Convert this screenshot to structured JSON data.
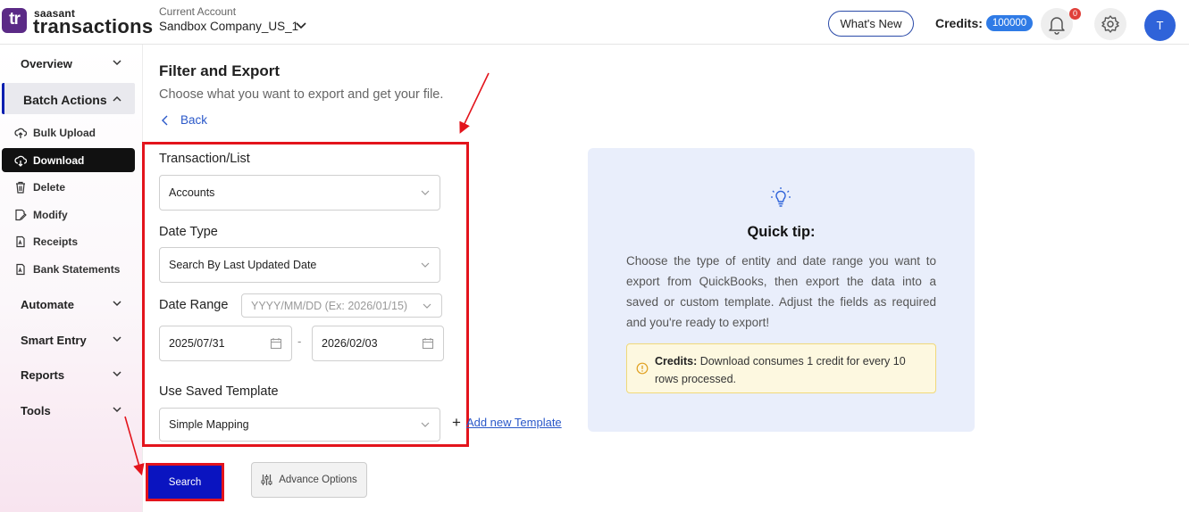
{
  "header": {
    "logo_mark": "tr",
    "logo_small": "saasant",
    "logo_big": "transactions",
    "account_label": "Current Account",
    "account_name": "Sandbox Company_US_1",
    "whats_new_label": "What's New",
    "credits_label": "Credits:",
    "credits_value": "100000",
    "notification_count": "0",
    "avatar_initial": "T",
    "icons": [
      "chevron-down-icon",
      "bell-icon",
      "gear-icon"
    ]
  },
  "sidebar": {
    "sections": [
      {
        "label": "Overview"
      },
      {
        "label": "Batch Actions"
      },
      {
        "label": "Automate"
      },
      {
        "label": "Smart Entry"
      },
      {
        "label": "Reports"
      },
      {
        "label": "Tools"
      }
    ],
    "batch_items": [
      {
        "label": "Bulk Upload",
        "icon": "cloud-upload-icon"
      },
      {
        "label": "Download",
        "icon": "cloud-download-icon",
        "active": true
      },
      {
        "label": "Delete",
        "icon": "trash-icon"
      },
      {
        "label": "Modify",
        "icon": "edit-document-icon"
      },
      {
        "label": "Receipts",
        "icon": "receipt-icon"
      },
      {
        "label": "Bank Statements",
        "icon": "bank-statement-icon"
      }
    ]
  },
  "main": {
    "title": "Filter and Export",
    "subtitle": "Choose what you want to export and get your file.",
    "back_label": "Back",
    "transaction_label": "Transaction/List",
    "transaction_value": "Accounts",
    "date_type_label": "Date Type",
    "date_type_value": "Search By Last Updated Date",
    "date_range_label": "Date Range",
    "date_range_placeholder": "YYYY/MM/DD (Ex: 2026/01/15)",
    "date_from": "2025/07/31",
    "date_separator": "-",
    "date_to": "2026/02/03",
    "template_label": "Use Saved Template",
    "template_value": "Simple Mapping",
    "add_template_plus": "+",
    "add_template_label": "Add new Template",
    "search_label": "Search",
    "advance_label": "Advance Options"
  },
  "tip": {
    "icon": "lightbulb-icon",
    "title": "Quick tip:",
    "body": "Choose the type of entity and date range you want to export from QuickBooks, then export the data into a saved or custom template. Adjust the fields as required and you're ready to export!",
    "credits_bold": "Credits:",
    "credits_text": " Download consumes 1 credit for every 10 rows processed."
  },
  "colors": {
    "accent_blue": "#0a14c0",
    "highlight_red": "#e3141c",
    "tip_background": "#e9eefb",
    "credits_badge": "#2f7be6"
  }
}
